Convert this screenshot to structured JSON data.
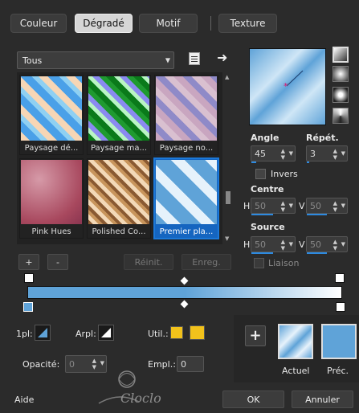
{
  "tabs": [
    {
      "label": "Couleur",
      "active": false
    },
    {
      "label": "Dégradé",
      "active": true
    },
    {
      "label": "Motif",
      "active": false
    },
    {
      "label": "Texture",
      "active": false
    }
  ],
  "category": {
    "value": "Tous"
  },
  "gradients": [
    {
      "label": "Paysage dé..."
    },
    {
      "label": "Paysage ma..."
    },
    {
      "label": "Paysage no..."
    },
    {
      "label": "Pink Hues"
    },
    {
      "label": "Polished Co..."
    },
    {
      "label": "Premier pla..."
    }
  ],
  "list_buttons": {
    "add": "+",
    "remove": "-",
    "reset": "Réinit.",
    "save": "Enreg."
  },
  "angle": {
    "label": "Angle",
    "value": "45"
  },
  "repeat": {
    "label": "Répét.",
    "value": "3"
  },
  "invert": {
    "label": "Invers",
    "checked": false
  },
  "center": {
    "label": "Centre",
    "h_label": "H",
    "h_value": "50",
    "v_label": "V",
    "v_value": "50"
  },
  "source": {
    "label": "Source",
    "h_label": "H",
    "h_value": "50",
    "v_label": "V",
    "v_value": "50"
  },
  "link": {
    "label": "Liaison",
    "checked": false
  },
  "bottom": {
    "stop_label": "1pl:",
    "arpl_label": "Arpl:",
    "util_label": "Util.:",
    "opacity_label": "Opacité:",
    "opacity_value": "0",
    "location_label": "Empl.:",
    "location_value": "0",
    "current_label": "Actuel",
    "prev_label": "Préc."
  },
  "footer": {
    "help": "Aide",
    "ok": "OK",
    "cancel": "Annuler",
    "watermark": "Cloclo"
  },
  "colors": {
    "accent": "#1b78d8",
    "util_swatch": "#f2c21b",
    "prev_swatch": "#5fa3d8",
    "gradient_start": "#5fa3d8",
    "gradient_end": "#ffffff"
  }
}
